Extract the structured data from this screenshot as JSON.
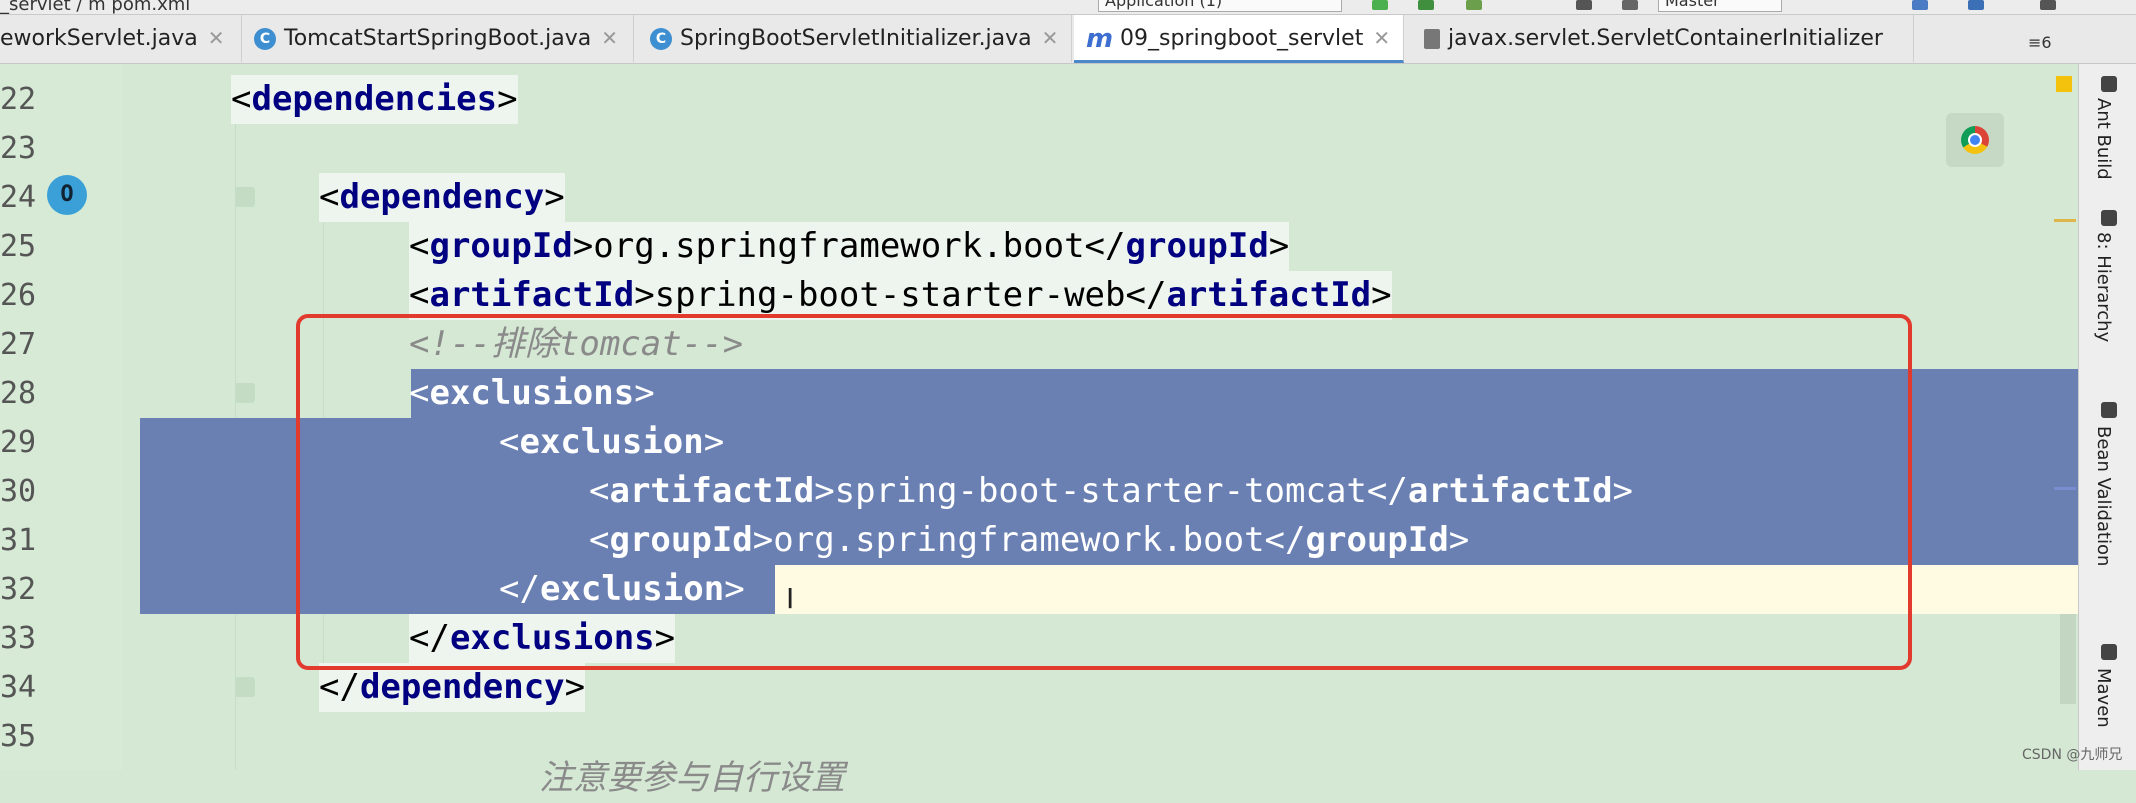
{
  "top_strip": {
    "breadcrumb": "_servlet / m pom.xml",
    "run_config": "Application (1)",
    "branch_box": "Master"
  },
  "tabs": [
    {
      "label": "eworkServlet.java",
      "icon": "class-icon"
    },
    {
      "label": "TomcatStartSpringBoot.java",
      "icon": "class-icon"
    },
    {
      "label": "SpringBootServletInitializer.java",
      "icon": "class-icon"
    },
    {
      "label": "09_springboot_servlet",
      "icon": "maven-icon",
      "active": true
    },
    {
      "label": "javax.servlet.ServletContainerInitializer",
      "icon": "text-file-icon"
    }
  ],
  "tab_overflow": "≡6",
  "tool_windows": [
    "Ant Build",
    "8: Hierarchy",
    "Bean Validation",
    "Maven"
  ],
  "line_numbers": [
    "22",
    "23",
    "24",
    "25",
    "26",
    "27",
    "28",
    "29",
    "30",
    "31",
    "32",
    "33",
    "34",
    "35"
  ],
  "code": {
    "l22": {
      "open": "<",
      "tag": "dependencies",
      "close": ">"
    },
    "l24": {
      "open": "<",
      "tag": "dependency",
      "close": ">"
    },
    "l25": {
      "tag": "groupId",
      "value": "org.springframework.boot"
    },
    "l26": {
      "tag": "artifactId",
      "value": "spring-boot-starter-web"
    },
    "l27": {
      "comment": "<!--排除tomcat-->"
    },
    "l28": {
      "tag": "exclusions"
    },
    "l29": {
      "tag": "exclusion"
    },
    "l30": {
      "tag": "artifactId",
      "value": "spring-boot-starter-tomcat"
    },
    "l31": {
      "tag": "groupId",
      "value": "org.springframework.boot"
    },
    "l32": {
      "tag": "exclusion"
    },
    "l33": {
      "tag": "exclusions"
    },
    "l34": {
      "tag": "dependency"
    },
    "l36": {
      "comment": "注意要参与自行设置"
    }
  },
  "watermark": "CSDN @九师兄",
  "colors": {
    "editor_bg": "#d4e8d4",
    "selection": "#6a7fb2",
    "tag": "#000080",
    "comment": "#8a8a8a",
    "highlight_box": "#e23b2e",
    "current_line": "#fffbe2"
  }
}
